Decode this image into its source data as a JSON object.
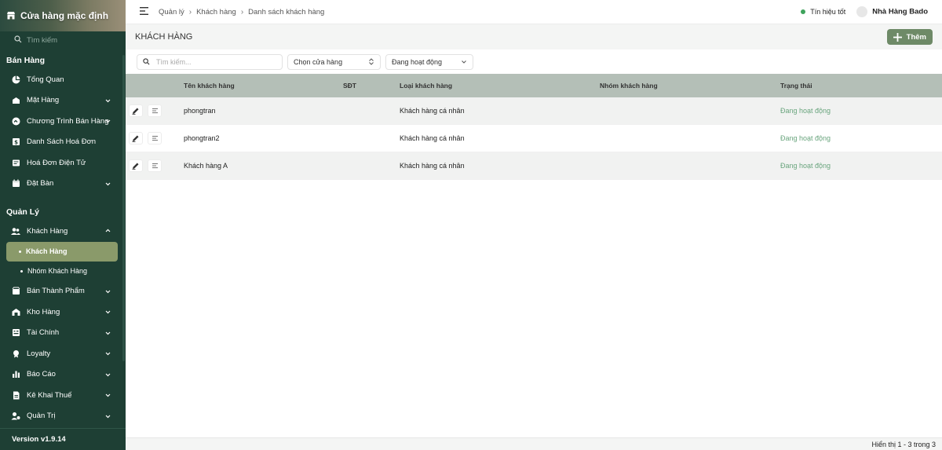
{
  "sidebar": {
    "store_name": "Cửa hàng mặc định",
    "search_placeholder": "Tìm kiếm",
    "section_sales": "Bán Hàng",
    "sales_items": [
      {
        "label": "Tổng Quan",
        "icon": "dashboard-icon"
      },
      {
        "label": "Mặt Hàng",
        "icon": "products-icon"
      },
      {
        "label": "Chương Trình Bán Hàng",
        "icon": "promotion-icon"
      },
      {
        "label": "Danh Sách Hoá Đơn",
        "icon": "invoice-icon"
      },
      {
        "label": "Hoá Đơn Điện Tử",
        "icon": "e-invoice-icon"
      },
      {
        "label": "Đặt Bàn",
        "icon": "calendar-icon"
      }
    ],
    "section_manage": "Quản Lý",
    "customers_label": "Khách Hàng",
    "customers_sub": [
      "Khách Hàng",
      "Nhóm Khách Hàng"
    ],
    "manage_items": [
      {
        "label": "Bán Thành Phẩm",
        "icon": "semi-product-icon"
      },
      {
        "label": "Kho Hàng",
        "icon": "warehouse-icon"
      },
      {
        "label": "Tài Chính",
        "icon": "finance-icon"
      },
      {
        "label": "Loyalty",
        "icon": "loyalty-icon"
      },
      {
        "label": "Báo Cáo",
        "icon": "report-icon"
      },
      {
        "label": "Kê Khai Thuế",
        "icon": "tax-icon"
      },
      {
        "label": "Quản Trị",
        "icon": "admin-icon"
      }
    ],
    "version": "Version v1.9.14"
  },
  "topbar": {
    "breadcrumb": [
      "Quản lý",
      "Khách hàng",
      "Danh sách khách hàng"
    ],
    "signal": "Tín hiệu tốt",
    "shop": "Nhà Hàng Bado"
  },
  "page": {
    "title": "KHÁCH HÀNG",
    "add_label": "Thêm"
  },
  "filters": {
    "search_placeholder": "Tìm kiếm...",
    "store_select": "Chọn cửa hàng",
    "status_select": "Đang hoạt động"
  },
  "table": {
    "headers": [
      "Tên khách hàng",
      "SĐT",
      "Loại khách hàng",
      "Nhóm khách hàng",
      "Trạng thái"
    ],
    "rows": [
      {
        "name": "phongtran",
        "phone": "",
        "type": "Khách hàng cá nhân",
        "group": "",
        "status": "Đang hoạt động"
      },
      {
        "name": "phongtran2",
        "phone": "",
        "type": "Khách hàng cá nhân",
        "group": "",
        "status": "Đang hoạt động"
      },
      {
        "name": "Khách hàng A",
        "phone": "",
        "type": "Khách hàng cá nhân",
        "group": "",
        "status": "Đang hoạt động"
      }
    ]
  },
  "footer": {
    "pagination": "Hiển thị 1 - 3 trong 3"
  },
  "colors": {
    "sidebar_bg": "#1e3f34",
    "accent": "#6e8a67",
    "status_active": "#6aa57e",
    "table_header": "#b4bfb7"
  }
}
